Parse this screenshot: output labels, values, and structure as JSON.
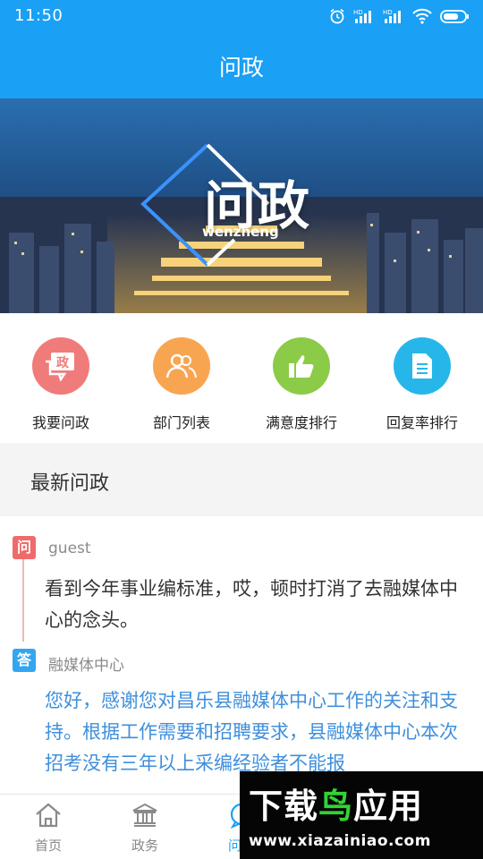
{
  "status_bar": {
    "time": "11:50",
    "icons": [
      "alarm-icon",
      "hd-signal-icon",
      "hd-signal-icon",
      "wifi-icon",
      "battery-icon"
    ]
  },
  "header": {
    "title": "问政"
  },
  "banner": {
    "title": "问政",
    "subtitle": "wenzheng"
  },
  "quick_entries": [
    {
      "label": "我要问政",
      "icon": "ask-icon",
      "color": "#f07b7b",
      "glyph": "政"
    },
    {
      "label": "部门列表",
      "icon": "people-icon",
      "color": "#f8a552"
    },
    {
      "label": "满意度排行",
      "icon": "thumbs-up-icon",
      "color": "#8ccb47"
    },
    {
      "label": "回复率排行",
      "icon": "document-icon",
      "color": "#27b6ea"
    }
  ],
  "latest": {
    "section_title": "最新问政",
    "item": {
      "ask_tag": "问",
      "user": "guest",
      "question": "看到今年事业编标准，哎，顿时打消了去融媒体中心的念头。",
      "answer_tag": "答",
      "replier": "融媒体中心",
      "answer": "您好，感谢您对昌乐县融媒体中心工作的关注和支持。根据工作需要和招聘要求，县融媒体中心本次招考没有三年以上采编经验者不能报"
    }
  },
  "bottom_nav": [
    {
      "label": "首页",
      "icon": "home-icon"
    },
    {
      "label": "政务",
      "icon": "government-icon"
    },
    {
      "label": "问政",
      "icon": "chat-icon",
      "active": true
    }
  ],
  "watermark": {
    "text": "下载鸟应用",
    "accent_char": "鸟",
    "url": "www.xiazainiao.com"
  },
  "colors": {
    "primary": "#1aa0f5",
    "answer_text": "#3f8fdc",
    "ask_tag": "#ef6b6b",
    "answer_tag": "#33a6f0"
  }
}
